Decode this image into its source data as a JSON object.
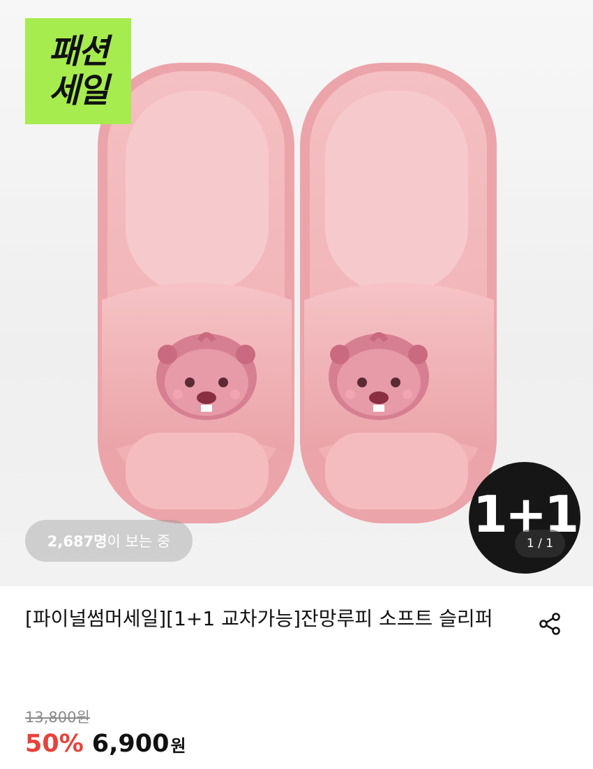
{
  "hero": {
    "sale_badge": {
      "line1": "패션",
      "line2": "세일"
    },
    "viewers": {
      "count": "2,687명",
      "suffix": "이 보는 중"
    },
    "one_plus_one": "1+1",
    "page_counter": "1 / 1",
    "image_description_icon": "pink-slide-slippers-image"
  },
  "product": {
    "title": "[파이널썸머세일][1+1 교차가능]잔망루피 소프트 슬리퍼",
    "original_price": "13,800원",
    "discount": "50%",
    "sale_price": "6,900",
    "currency": "원"
  },
  "icons": {
    "share": "share-icon"
  },
  "colors": {
    "badge_green": "#a6ec4f",
    "discount_red": "#e8413a",
    "slipper_pink": "#f2b5b9"
  }
}
